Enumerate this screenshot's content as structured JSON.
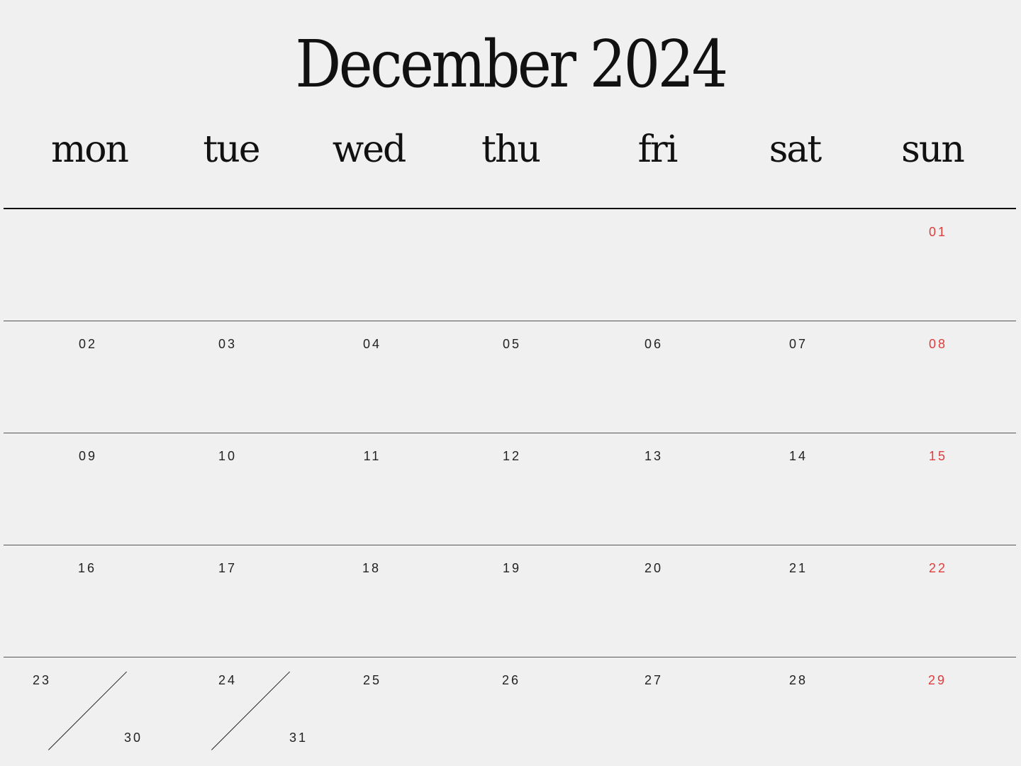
{
  "title": "December 2024",
  "weekdays": [
    "mon",
    "tue",
    "wed",
    "thu",
    "fri",
    "sat",
    "sun"
  ],
  "weeks": [
    [
      "",
      "",
      "",
      "",
      "",
      "",
      "01"
    ],
    [
      "02",
      "03",
      "04",
      "05",
      "06",
      "07",
      "08"
    ],
    [
      "09",
      "10",
      "11",
      "12",
      "13",
      "14",
      "15"
    ],
    [
      "16",
      "17",
      "18",
      "19",
      "20",
      "21",
      "22"
    ],
    [
      "23",
      "24",
      "25",
      "26",
      "27",
      "28",
      "29"
    ]
  ],
  "overflow_dates": {
    "mon": "30",
    "tue": "31"
  },
  "colors": {
    "background": "#f0f0f0",
    "text": "#111111",
    "sunday": "#e03c3c",
    "rule": "#555555"
  }
}
